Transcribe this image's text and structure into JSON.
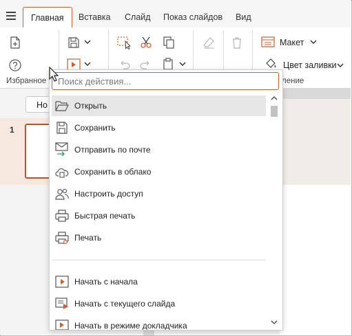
{
  "tabs": [
    {
      "label": "Главная",
      "active": true
    },
    {
      "label": "Вставка"
    },
    {
      "label": "Слайд"
    },
    {
      "label": "Показ слайдов"
    },
    {
      "label": "Вид"
    }
  ],
  "ribbon": {
    "favorites_caption": "Избранное",
    "layout_label": "Макет",
    "fill_color_label": "Цвет заливки",
    "partial_caption": "ление"
  },
  "slides_panel": {
    "new_slide_label": "Но",
    "slide_number": "1"
  },
  "quick_menu": {
    "search_placeholder": "Поиск действия...",
    "items": [
      {
        "label": "Открыть",
        "icon": "folder-open-icon"
      },
      {
        "label": "Сохранить",
        "icon": "save-icon"
      },
      {
        "label": "Отправить по почте",
        "icon": "mail-send-icon"
      },
      {
        "label": "Сохранить в облако",
        "icon": "cloud-upload-icon"
      },
      {
        "label": "Настроить доступ",
        "icon": "share-users-icon"
      },
      {
        "label": "Быстрая печать",
        "icon": "quick-print-icon"
      },
      {
        "label": "Печать",
        "icon": "print-icon"
      },
      {
        "label": "Начать с начала",
        "icon": "play-start-icon"
      },
      {
        "label": "Начать с текущего слайда",
        "icon": "play-current-icon"
      },
      {
        "label": "Начать в режиме докладчика",
        "icon": "presenter-icon"
      }
    ]
  },
  "colors": {
    "accent": "#c9602f",
    "selection_bg": "#f6e7df"
  }
}
